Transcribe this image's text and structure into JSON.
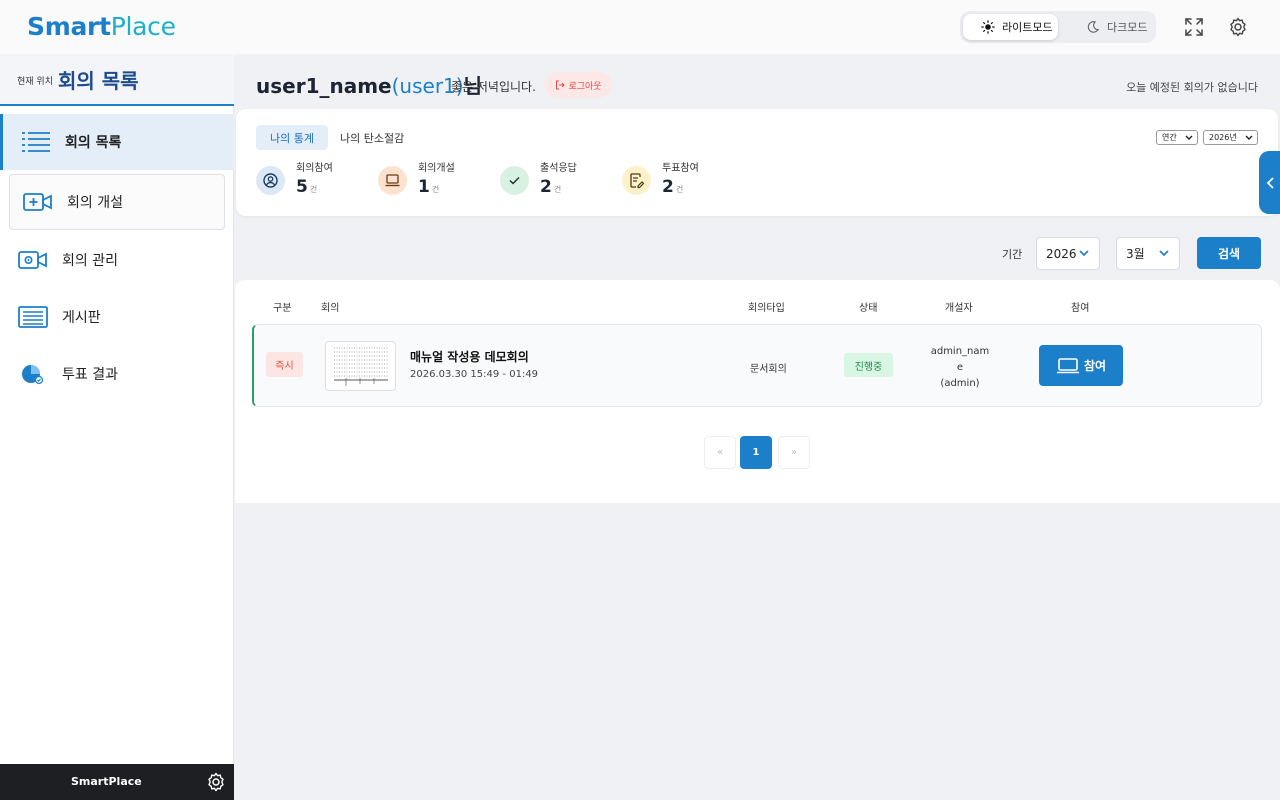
{
  "header": {
    "logo_a": "Smart",
    "logo_b": "Place",
    "light_mode": "라이트모드",
    "dark_mode": "다크모드"
  },
  "sidebar": {
    "location_label": "현재 위치",
    "location_title": "회의 목록",
    "items": [
      {
        "label": "회의 목록",
        "icon": "list-icon"
      },
      {
        "label": "회의 개설",
        "icon": "video-add-icon"
      },
      {
        "label": "회의 관리",
        "icon": "video-settings-icon"
      },
      {
        "label": "게시판",
        "icon": "board-icon"
      },
      {
        "label": "투표 결과",
        "icon": "pie-chart-icon"
      }
    ],
    "footer_title": "SmartPlace"
  },
  "greeting": {
    "name": "user1_name",
    "uid": "(user1)",
    "suffix": "님",
    "message": "좋은 저녁입니다.",
    "logout": "로그아웃",
    "today": "오늘 예정된 회의가 없습니다"
  },
  "stats": {
    "tab_active": "나의 통계",
    "tab_other": "나의 탄소절감",
    "period_select": "연간",
    "year_select": "2026년",
    "items": [
      {
        "label": "회의참여",
        "value": "5",
        "unit": "건"
      },
      {
        "label": "회의개설",
        "value": "1",
        "unit": "건"
      },
      {
        "label": "출석응답",
        "value": "2",
        "unit": "건"
      },
      {
        "label": "투표참여",
        "value": "2",
        "unit": "건"
      }
    ]
  },
  "filter": {
    "label": "기간",
    "year": "2026",
    "month": "3월",
    "search": "검색"
  },
  "table": {
    "headers": [
      "구분",
      "회의",
      "회의타입",
      "상태",
      "개설자",
      "참여"
    ],
    "rows": [
      {
        "category": "즉시",
        "title": "매뉴얼 작성용 데모회의",
        "datetime": "2026.03.30 15:49 - 01:49",
        "type": "문서회의",
        "status": "진행중",
        "creator_1": "admin_nam",
        "creator_2": "e",
        "creator_3": "(admin)",
        "join": "참여"
      }
    ]
  },
  "pagination": {
    "prev": "«",
    "current": "1",
    "next": "»"
  },
  "colors": {
    "primary": "#1c7fc9",
    "status_green": "#1f8c4c",
    "badge_red": "#e0503f"
  }
}
